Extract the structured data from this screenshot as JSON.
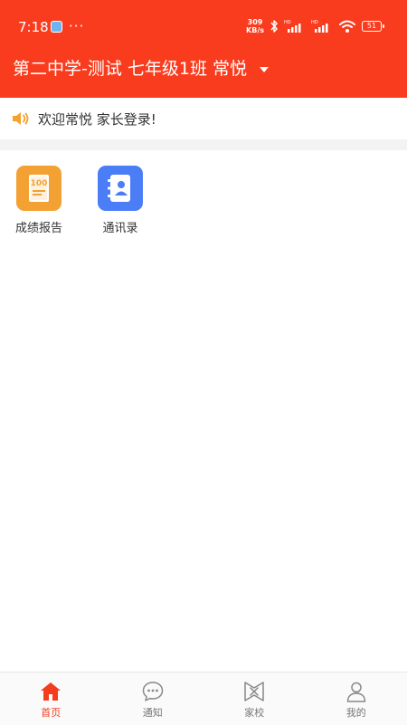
{
  "status_bar": {
    "time": "7:18",
    "overflow": "···",
    "net_speed_value": "309",
    "net_speed_unit": "KB/s",
    "battery": "51"
  },
  "header": {
    "title": "第二中学-测试 七年级1班 常悦",
    "bg_color": "#fa3c1e"
  },
  "notice": {
    "icon": "speaker-icon",
    "text": "欢迎常悦 家长登录!"
  },
  "apps": [
    {
      "label": "成绩报告",
      "icon": "score-report-icon",
      "icon_text": "100",
      "color": "#f3a132"
    },
    {
      "label": "通讯录",
      "icon": "contacts-icon",
      "color": "#4a7df6"
    }
  ],
  "tabs": [
    {
      "label": "首页",
      "icon": "home-icon",
      "active": true
    },
    {
      "label": "通知",
      "icon": "message-icon",
      "active": false
    },
    {
      "label": "家校",
      "icon": "home-school-icon",
      "active": false
    },
    {
      "label": "我的",
      "icon": "user-icon",
      "active": false
    }
  ],
  "colors": {
    "accent": "#f43d1f",
    "inactive": "#777777"
  }
}
